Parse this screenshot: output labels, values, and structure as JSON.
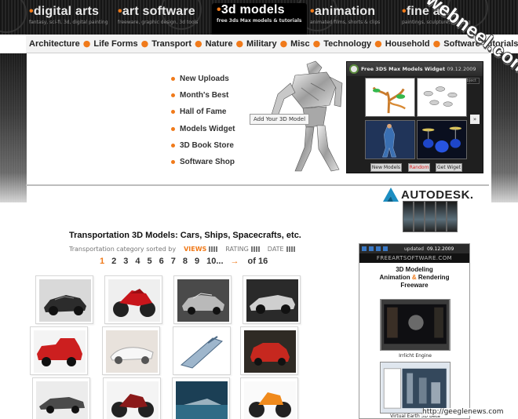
{
  "header": {
    "sections": [
      {
        "label": "digital arts",
        "sub": "fantasy, sci-fi, 3d, digital painting"
      },
      {
        "label": "art software",
        "sub": "freeware, graphic design, 3d tools"
      },
      {
        "label": "3d models",
        "sub": "free 3ds Max models & tutorials"
      },
      {
        "label": "animation",
        "sub": "animated films, shorts & clips"
      },
      {
        "label": "fine art",
        "sub": "paintings, sculpture, drawing"
      }
    ]
  },
  "categories": [
    "Architecture",
    "Life Forms",
    "Transport",
    "Nature",
    "Military",
    "Misc",
    "Technology",
    "Household",
    "Software Tutorials"
  ],
  "quick_links": [
    "New Uploads",
    "Month's Best",
    "Hall of Fame",
    "Models Widget",
    "3D Book Store",
    "Software Shop"
  ],
  "add_model_label": "Add Your 3D Model",
  "widget": {
    "title": "Free 3DS Max Models Widget",
    "date": "09.12.2009",
    "object_label": "Object",
    "buttons": [
      "New Models",
      "Random",
      "Get Wiget"
    ]
  },
  "sponsor": {
    "name": "AUTODESK."
  },
  "listing": {
    "title": "Transportation 3D Models: Cars, Ships, Spacecrafts, etc.",
    "sort_intro": "Transportation category sorted by",
    "sort_views": "VIEWS",
    "sort_rating": "RATING",
    "sort_date": "DATE",
    "pages": [
      "1",
      "2",
      "3",
      "4",
      "5",
      "6",
      "7",
      "8",
      "9",
      "10...",
      "→",
      "of 16"
    ]
  },
  "ad": {
    "bar_label": "updated",
    "bar_date": "09.12.2009",
    "brand": "FREEARTSOFTWARE.COM",
    "line1": "3D Modeling",
    "line2a": "Animation",
    "line2b": "&",
    "line2c": "Rendering",
    "line3": "Freeware",
    "captions": [
      "Irrlicht Engine",
      "Virtual Earth 3D Beta"
    ]
  },
  "watermark": "webneel.com",
  "footer_url": "http://geeglenews.com"
}
